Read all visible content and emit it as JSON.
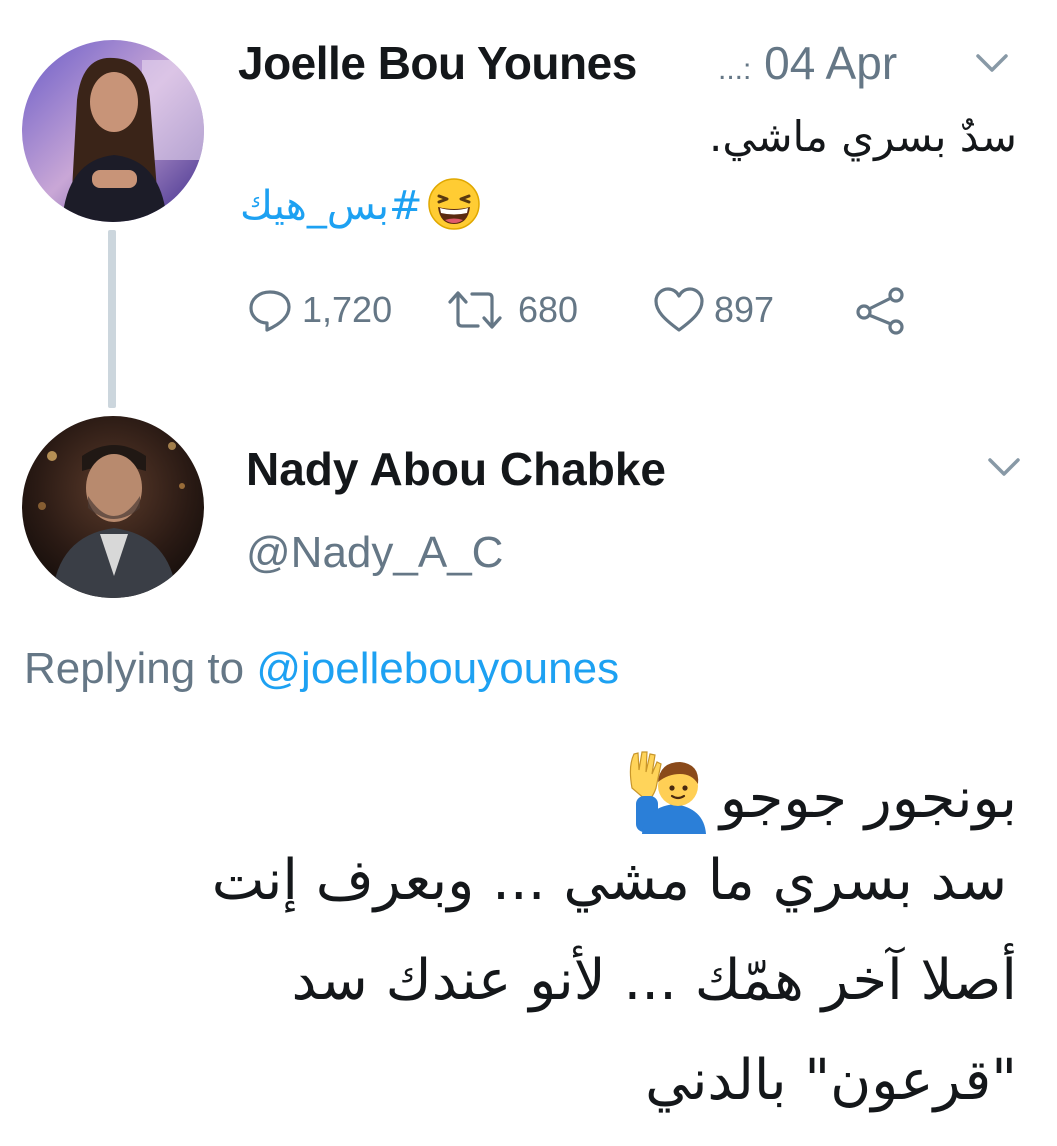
{
  "tweet": {
    "author_name": "Joelle Bou Younes",
    "ellipsis": "...",
    "separator": ":",
    "date": "04 Apr",
    "text": "سدٌ بسري ماشي.",
    "hashtag": "#بس_هيك",
    "emoji": "grinning-squinting-face",
    "stats": {
      "replies": "1,720",
      "retweets": "680",
      "likes": "897"
    }
  },
  "reply": {
    "author_name": "Nady Abou Chabke",
    "handle": "@Nady_A_C",
    "replying_prefix": "Replying to",
    "replying_to": "@joellebouyounes",
    "line1": "بونجور جوجو",
    "emoji": "person-raising-hand",
    "line2": "سد بسري ما مشي ... وبعرف إنت",
    "line3": "أصلا آخر همّك ... لأنو عندك سد",
    "line4": "\"قرعون\" بالدني"
  },
  "colors": {
    "link": "#1da1f2",
    "muted": "#657786",
    "text": "#14171a",
    "thread_line": "#ccd6dd"
  }
}
